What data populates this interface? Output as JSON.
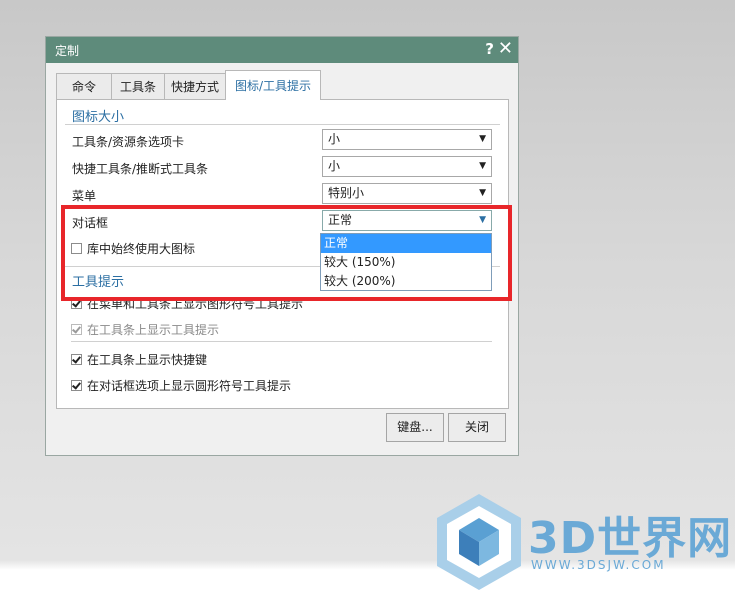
{
  "dialog": {
    "title": "定制",
    "help_label": "?",
    "close_label": "✕",
    "tabs": [
      {
        "label": "命令"
      },
      {
        "label": "工具条"
      },
      {
        "label": "快捷方式"
      },
      {
        "label": "图标/工具提示"
      }
    ],
    "icon_size": {
      "heading": "图标大小",
      "rows": [
        {
          "label": "工具条/资源条选项卡",
          "value": "小"
        },
        {
          "label": "快捷工具条/推断式工具条",
          "value": "小"
        },
        {
          "label": "菜单",
          "value": "特别小"
        },
        {
          "label": "对话框",
          "value": "正常"
        }
      ],
      "library_checkbox": {
        "label": "库中始终使用大图标",
        "checked": false
      }
    },
    "dropdown_options": [
      "正常",
      "较大 (150%)",
      "较大 (200%)"
    ],
    "tooltips": {
      "heading": "工具提示",
      "checkboxes": [
        {
          "label": "在菜单和工具条上显示图形符号工具提示",
          "checked": true,
          "disabled": false
        },
        {
          "label": "在工具条上显示工具提示",
          "checked": true,
          "disabled": true
        },
        {
          "label": "在工具条上显示快捷键",
          "checked": true,
          "disabled": false
        },
        {
          "label": "在对话框选项上显示圆形符号工具提示",
          "checked": true,
          "disabled": false
        }
      ]
    },
    "buttons": {
      "keyboard": "键盘...",
      "close": "关闭"
    }
  },
  "watermark": {
    "text": "3D世界网",
    "url": "WWW.3DSJW.COM"
  },
  "colors": {
    "titlebar": "#5e8b7b",
    "accent": "#2c6fa3",
    "highlight": "#e8262a",
    "selection": "#3399ff"
  }
}
